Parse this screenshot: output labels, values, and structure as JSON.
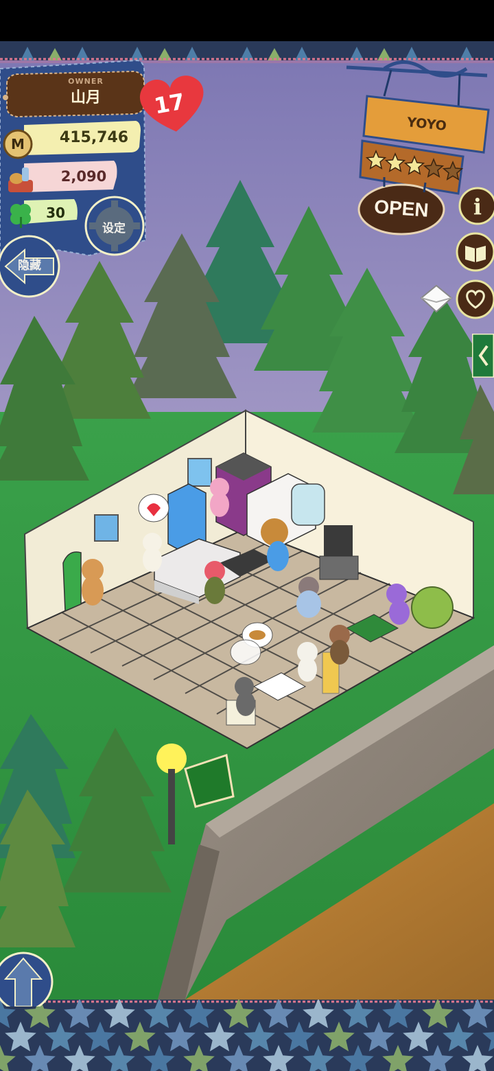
{
  "hud": {
    "owner_label": "OWNER",
    "owner_name": "山月",
    "money": "415,746",
    "bread": "2,090",
    "clover": "30",
    "settings_label": "设定",
    "hide_label": "隐藏",
    "heart_level": "17"
  },
  "shop": {
    "name": "YOYO",
    "status": "OPEN",
    "rating_stars": 3,
    "max_stars": 5
  },
  "icons": [
    "money-icon",
    "bread-basket-icon",
    "clover-icon",
    "gear-icon",
    "back-arrow-icon",
    "info-icon",
    "recipe-book-icon",
    "heart-chat-icon",
    "mail-icon",
    "side-panel-arrow-icon",
    "scroll-up-arrow-icon"
  ],
  "colors": {
    "denim": "#2f4d8a",
    "grass": "#2f8a3c",
    "sky": "#8c84b8",
    "sign_wood": "#d9912f",
    "heart": "#e8383e"
  }
}
